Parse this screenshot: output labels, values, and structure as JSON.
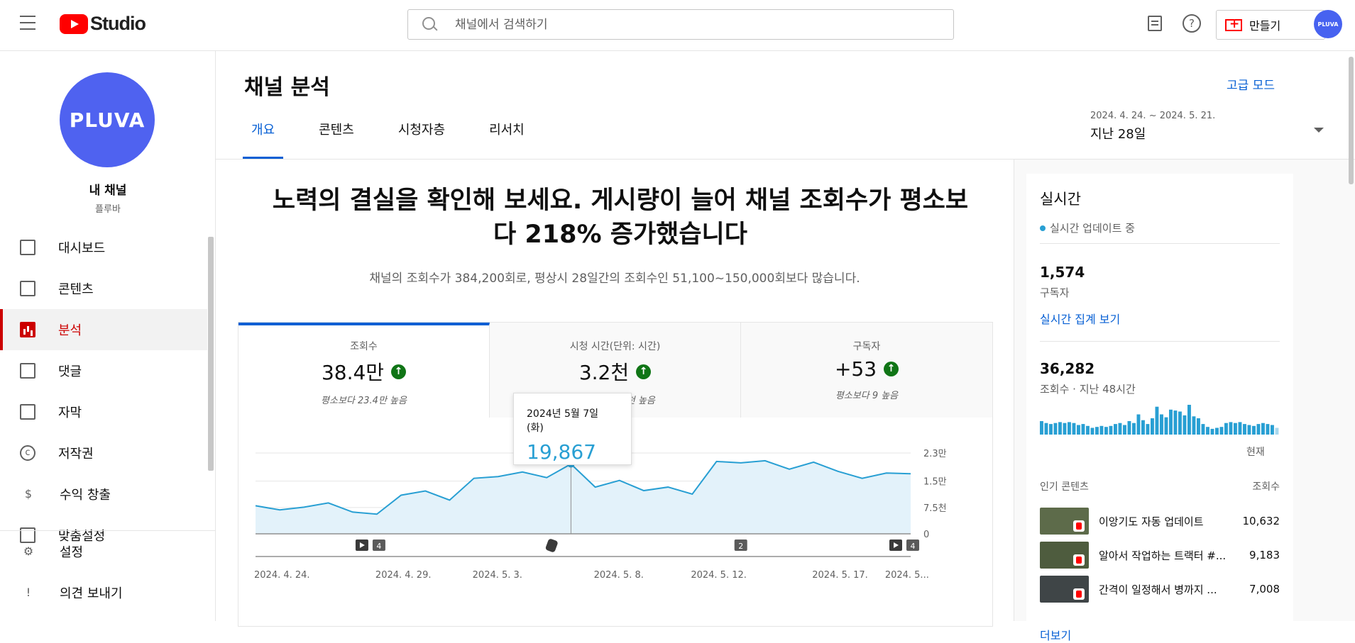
{
  "header": {
    "logo_text": "Studio",
    "search_placeholder": "채널에서 검색하기",
    "create_label": "만들기",
    "avatar_text": "PLUVA",
    "help_glyph": "?"
  },
  "sidebar": {
    "avatar_text": "PLUVA",
    "channel_title": "내 채널",
    "channel_handle": "플루바",
    "items": [
      {
        "label": "대시보드",
        "icon": "dashboard-icon"
      },
      {
        "label": "콘텐츠",
        "icon": "content-icon"
      },
      {
        "label": "분석",
        "icon": "analytics-icon",
        "active": true
      },
      {
        "label": "댓글",
        "icon": "comments-icon"
      },
      {
        "label": "자막",
        "icon": "subtitles-icon"
      },
      {
        "label": "저작권",
        "icon": "copyright-icon",
        "glyph": "c"
      },
      {
        "label": "수익 창출",
        "icon": "monetization-icon",
        "glyph": "$"
      },
      {
        "label": "맞춤설정",
        "icon": "customization-icon"
      }
    ],
    "bottom_items": [
      {
        "label": "설정",
        "icon": "settings-icon",
        "glyph": "⚙"
      },
      {
        "label": "의견 보내기",
        "icon": "feedback-icon",
        "glyph": "!"
      }
    ]
  },
  "page": {
    "title": "채널 분석",
    "advanced_mode": "고급 모드",
    "tabs": [
      "개요",
      "콘텐츠",
      "시청자층",
      "리서치"
    ],
    "active_tab": "개요",
    "date_range": "2024. 4. 24. ~ 2024. 5. 21.",
    "date_period": "지난 28일"
  },
  "overview": {
    "headline": "노력의 결실을 확인해 보세요. 게시량이 늘어 채널 조회수가 평소보다 218% 증가했습니다",
    "subline": "채널의 조회수가 384,200회로, 평상시 28일간의 조회수인 51,100~150,000회보다 많습니다.",
    "metrics": [
      {
        "label": "조회수",
        "value": "38.4만",
        "note": "평소보다 23.4만 높음",
        "trend": "up"
      },
      {
        "label": "시청 시간(단위: 시간)",
        "value": "3.2천",
        "note": "평소보다 1.9천 높음",
        "trend": "up"
      },
      {
        "label": "구독자",
        "value": "+53",
        "note": "평소보다 9 높음",
        "trend": "up"
      }
    ],
    "up_glyph": "↑",
    "tooltip": {
      "date": "2024년 5월 7일 (화)",
      "value": "19,867"
    }
  },
  "chart_data": {
    "type": "area",
    "x": [
      "2024-04-24",
      "2024-04-25",
      "2024-04-26",
      "2024-04-27",
      "2024-04-28",
      "2024-04-29",
      "2024-04-30",
      "2024-05-01",
      "2024-05-02",
      "2024-05-03",
      "2024-05-04",
      "2024-05-05",
      "2024-05-06",
      "2024-05-07",
      "2024-05-08",
      "2024-05-09",
      "2024-05-10",
      "2024-05-11",
      "2024-05-12",
      "2024-05-13",
      "2024-05-14",
      "2024-05-15",
      "2024-05-16",
      "2024-05-17",
      "2024-05-18",
      "2024-05-19",
      "2024-05-20",
      "2024-05-21"
    ],
    "values": [
      8000,
      6800,
      7600,
      8800,
      6200,
      5600,
      11000,
      12200,
      9600,
      15800,
      16300,
      17600,
      16000,
      19867,
      13300,
      15200,
      12300,
      13300,
      11300,
      20600,
      20200,
      20800,
      18400,
      20400,
      17800,
      15800,
      17300,
      17100
    ],
    "y_ticks": [
      "0",
      "7.5천",
      "1.5만",
      "2.3만"
    ],
    "y_tick_values": [
      0,
      7500,
      15000,
      23000
    ],
    "ylim": [
      0,
      23000
    ],
    "x_tick_labels": [
      "2024. 4. 24.",
      "2024. 4. 29.",
      "2024. 5. 3.",
      "2024. 5. 8.",
      "2024. 5. 12.",
      "2024. 5. 17.",
      "2024. 5..."
    ],
    "x_tick_index": [
      0,
      5,
      9,
      14,
      18,
      23,
      26
    ],
    "highlight_index": 13,
    "markers": [
      {
        "index": 5,
        "type": "video",
        "count": "4"
      },
      {
        "index": 13,
        "type": "shorts",
        "count": ""
      },
      {
        "index": 20,
        "type": "count",
        "count": "2"
      },
      {
        "index": 27,
        "type": "video",
        "count": "4"
      }
    ],
    "color": "#289fd3",
    "fill": "#e3f2fa"
  },
  "realtime": {
    "title": "실시간",
    "status": "실시간 업데이트 중",
    "subscribers": "1,574",
    "subscribers_label": "구독자",
    "live_link": "실시간 집계 보기",
    "views": "36,282",
    "views_label": "조회수 · 지난 48시간",
    "now_label": "현재",
    "bars": [
      14,
      12,
      11,
      12,
      13,
      12,
      13,
      12,
      10,
      11,
      9,
      7,
      8,
      9,
      8,
      9,
      11,
      12,
      10,
      14,
      12,
      21,
      15,
      11,
      17,
      29,
      21,
      18,
      26,
      25,
      24,
      20,
      31,
      19,
      17,
      11,
      8,
      6,
      7,
      8,
      12,
      13,
      12,
      13,
      11,
      10,
      9,
      11,
      12,
      11,
      10,
      7
    ],
    "popular_header": "인기 콘텐츠",
    "popular_views_header": "조회수",
    "popular": [
      {
        "title": "이앙기도 자동 업데이트",
        "views": "10,632"
      },
      {
        "title": "알아서 작업하는 트랙터 #...",
        "views": "9,183"
      },
      {
        "title": "간격이 일정해서 병까지 ...",
        "views": "7,008"
      }
    ],
    "more": "더보기"
  }
}
